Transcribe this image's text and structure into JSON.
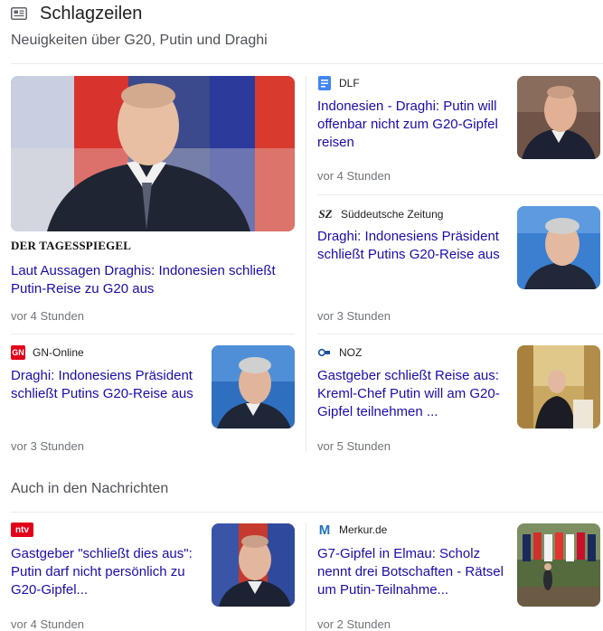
{
  "header": {
    "title": "Schlagzeilen",
    "subtitle": "Neuigkeiten über G20, Putin und Draghi"
  },
  "cards": [
    {
      "source": "DER TAGESSPIEGEL",
      "headline": "Laut Aussagen Draghis: Indonesien schließt Putin-Reise zu G20 aus",
      "time": "vor 4 Stunden"
    },
    {
      "source": "DLF",
      "headline": "Indonesien - Draghi: Putin will offenbar nicht zum G20-Gipfel reisen",
      "time": "vor 4 Stunden"
    },
    {
      "source": "Süddeutsche Zeitung",
      "logo": "SZ",
      "headline": "Draghi: Indonesiens Präsident schließt Putins G20-Reise aus",
      "time": "vor 3 Stunden"
    },
    {
      "source": "GN-Online",
      "logo": "GN",
      "headline": "Draghi: Indonesiens Präsident schließt Putins G20-Reise aus",
      "time": "vor 3 Stunden"
    },
    {
      "source": "NOZ",
      "headline": "Gastgeber schließt Reise aus: Kreml-Chef Putin will am G20-Gipfel teilnehmen ...",
      "time": "vor 5 Stunden"
    }
  ],
  "section2": {
    "title": "Auch in den Nachrichten"
  },
  "more_cards": [
    {
      "source": "",
      "logo": "ntv",
      "headline": "Gastgeber \"schließt dies aus\": Putin darf nicht persönlich zu G20-Gipfel...",
      "time": "vor 4 Stunden"
    },
    {
      "source": "Merkur.de",
      "logo": "M",
      "headline": "G7-Gipfel in Elmau: Scholz nennt drei Botschaften - Rätsel um Putin-Teilnahme...",
      "time": "vor 2 Stunden"
    }
  ],
  "colors": {
    "link": "#1a0dab",
    "meta": "#70757a",
    "divider": "#ebebeb"
  }
}
